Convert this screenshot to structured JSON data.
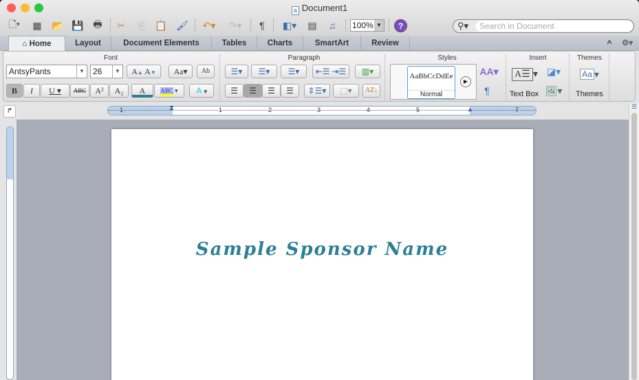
{
  "window": {
    "title": "Document1"
  },
  "toolbar": {
    "zoom": "100%",
    "search_placeholder": "Search in Document",
    "pilcrow": "¶",
    "help": "?"
  },
  "tabs": [
    "Home",
    "Layout",
    "Document Elements",
    "Tables",
    "Charts",
    "SmartArt",
    "Review"
  ],
  "active_tab": "Home",
  "ribbon": {
    "groups": {
      "font": "Font",
      "paragraph": "Paragraph",
      "styles": "Styles",
      "insert": "Insert",
      "themes": "Themes"
    },
    "font_name": "AntsyPants",
    "font_size": "26",
    "bold": "B",
    "italic": "I",
    "underline": "U",
    "strike": "ABC",
    "superscript": "A²",
    "subscript": "A₂",
    "font_color": "A",
    "highlight": "ABC",
    "text_effects": "A",
    "style_preview": "AaBbCcDdEe",
    "style_name": "Normal",
    "text_box": "Text Box",
    "themes_label": "Themes"
  },
  "ruler": {
    "labels": [
      "1",
      "1",
      "2",
      "3",
      "4",
      "5",
      "7"
    ]
  },
  "document": {
    "text": "Sample Sponsor Name",
    "text_color": "#2d7f95"
  }
}
